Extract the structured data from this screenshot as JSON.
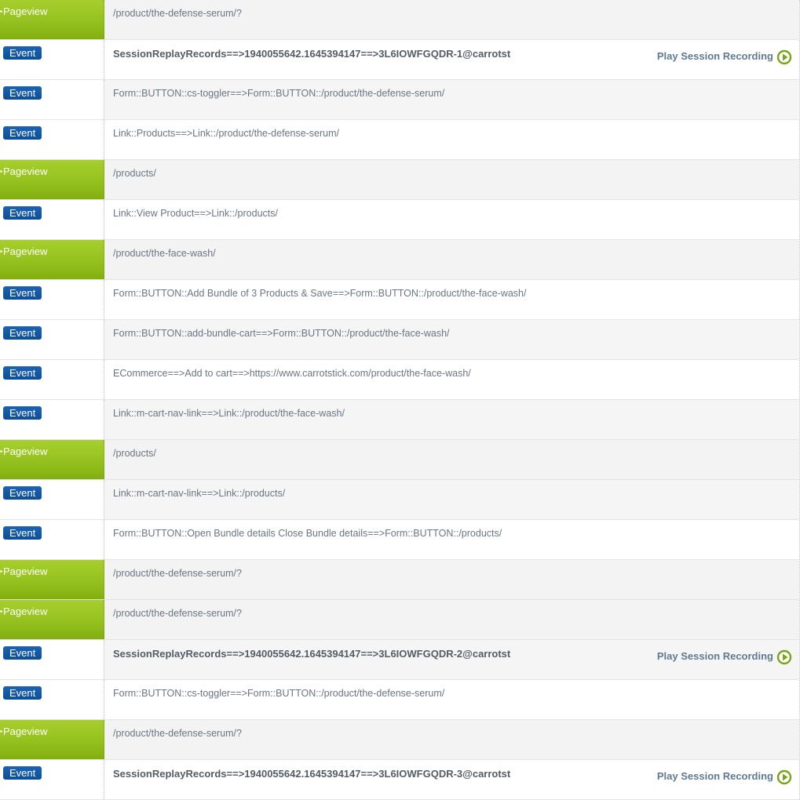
{
  "labels": {
    "pageview": "Pageview",
    "event": "Event",
    "play_recording": "Play Session Recording"
  },
  "colors": {
    "pageview_green": "#95c11f",
    "event_blue": "#0d4e99",
    "play_icon_green": "#7aa31a",
    "text_gray": "#6a7683"
  },
  "rows": [
    {
      "type": "pageview",
      "text": "/product/the-defense-serum/?"
    },
    {
      "type": "event",
      "text": "SessionReplayRecords==>1940055642.1645394147==>3L6IOWFGQDR-1@carrotst",
      "recording": true
    },
    {
      "type": "event",
      "text": "Form::BUTTON::cs-toggler==>Form::BUTTON::/product/the-defense-serum/"
    },
    {
      "type": "event",
      "text": "Link::Products==>Link::/product/the-defense-serum/"
    },
    {
      "type": "pageview",
      "text": "/products/"
    },
    {
      "type": "event",
      "text": "Link::View Product==>Link::/products/"
    },
    {
      "type": "pageview",
      "text": "/product/the-face-wash/"
    },
    {
      "type": "event",
      "text": "Form::BUTTON::Add Bundle of 3 Products & Save==>Form::BUTTON::/product/the-face-wash/"
    },
    {
      "type": "event",
      "text": "Form::BUTTON::add-bundle-cart==>Form::BUTTON::/product/the-face-wash/"
    },
    {
      "type": "event",
      "text": "ECommerce==>Add to cart==>https://www.carrotstick.com/product/the-face-wash/"
    },
    {
      "type": "event",
      "text": "Link::m-cart-nav-link==>Link::/product/the-face-wash/"
    },
    {
      "type": "pageview",
      "text": "/products/"
    },
    {
      "type": "event",
      "text": "Link::m-cart-nav-link==>Link::/products/"
    },
    {
      "type": "event",
      "text": "Form::BUTTON::Open Bundle details Close Bundle details==>Form::BUTTON::/products/"
    },
    {
      "type": "pageview",
      "text": "/product/the-defense-serum/?"
    },
    {
      "type": "pageview",
      "text": "/product/the-defense-serum/?"
    },
    {
      "type": "event",
      "text": "SessionReplayRecords==>1940055642.1645394147==>3L6IOWFGQDR-2@carrotst",
      "recording": true
    },
    {
      "type": "event",
      "text": "Form::BUTTON::cs-toggler==>Form::BUTTON::/product/the-defense-serum/"
    },
    {
      "type": "pageview",
      "text": "/product/the-defense-serum/?"
    },
    {
      "type": "event",
      "text": "SessionReplayRecords==>1940055642.1645394147==>3L6IOWFGQDR-3@carrotst",
      "recording": true
    }
  ]
}
